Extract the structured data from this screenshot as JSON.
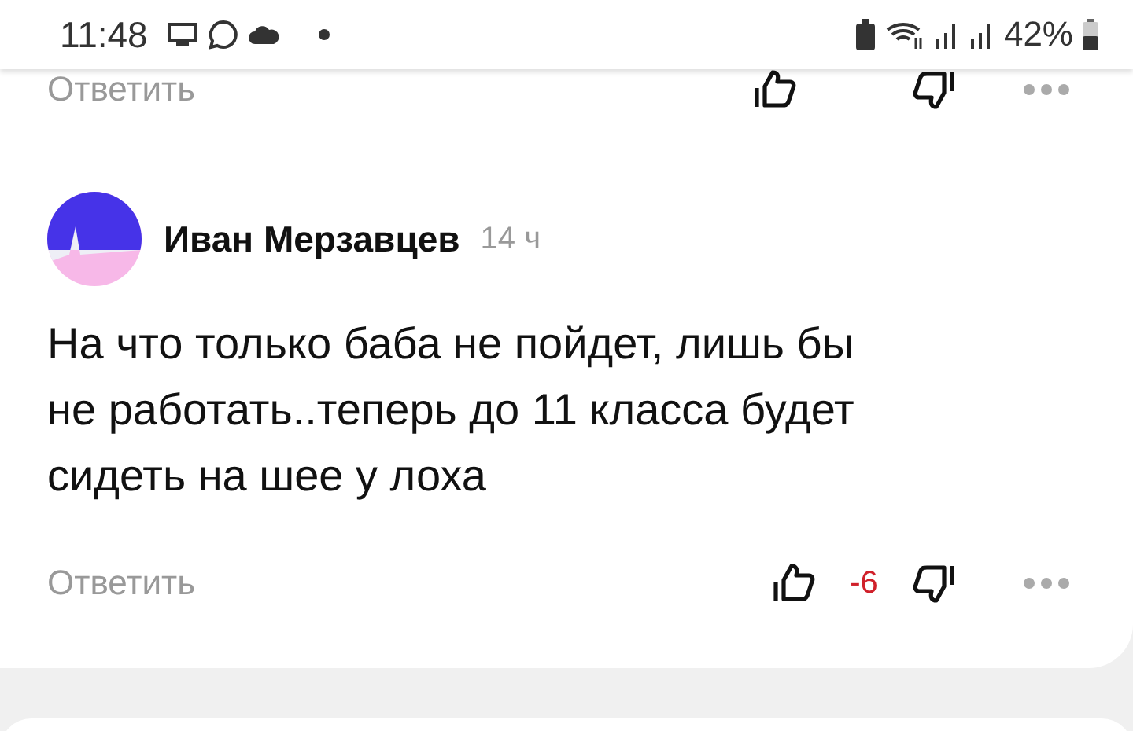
{
  "status_bar": {
    "time": "11:48",
    "battery": "42%"
  },
  "previous_comment": {
    "reply": "Ответить"
  },
  "comment": {
    "author": "Иван Мерзавцев",
    "time": "14 ч",
    "text": "На что только баба не пойдет, лишь бы не работать..теперь до 11 класса будет сидеть на шее у лоха",
    "reply": "Ответить",
    "rating": "-6"
  }
}
